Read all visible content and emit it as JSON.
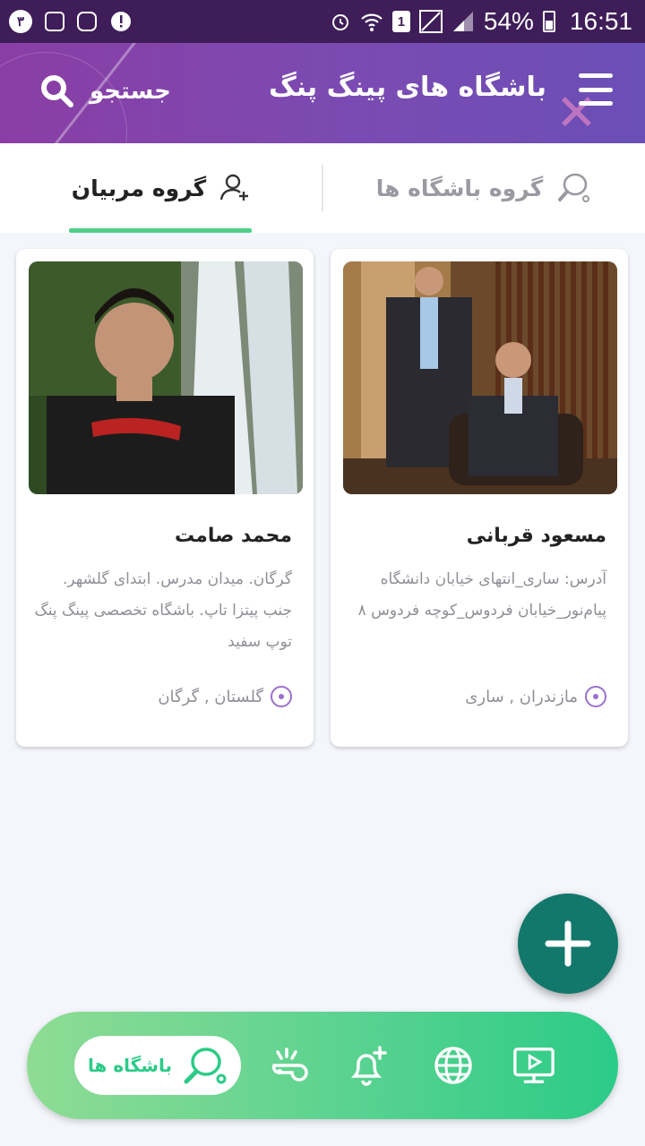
{
  "status_bar": {
    "notification_count": "٣",
    "sim_slot": "1",
    "battery": "54%",
    "time": "16:51"
  },
  "header": {
    "title": "باشگاه های پینگ پنگ",
    "search_label": "جستجو"
  },
  "tabs": [
    {
      "label": "گروه مربیان",
      "active": true
    },
    {
      "label": "گروه باشگاه ها",
      "active": false
    }
  ],
  "cards": [
    {
      "name": "مسعود قربانی",
      "description": "آدرس: ساری_انتهای خیابان دانشگاه پیام‌نور_خیابان فردوس_کوچه فردوس ۸",
      "location": "مازندران , ساری"
    },
    {
      "name": "محمد صامت",
      "description": "گرگان. میدان مدرس. ابتدای گلشهر. جنب پیتزا تاپ. باشگاه تخصصی پینگ پنگ توپ سفید",
      "location": "گلستان , گرگان"
    }
  ],
  "bottom_nav": {
    "active_label": "باشگاه ها",
    "items": [
      "clubs-icon",
      "whistle-icon",
      "bell-plus-icon",
      "globe-icon",
      "video-icon"
    ]
  },
  "colors": {
    "header_start": "#8a3ea5",
    "header_end": "#6a4fb6",
    "accent_green": "#4fd08a",
    "fab": "#12786b",
    "pin": "#9b6fd0"
  }
}
